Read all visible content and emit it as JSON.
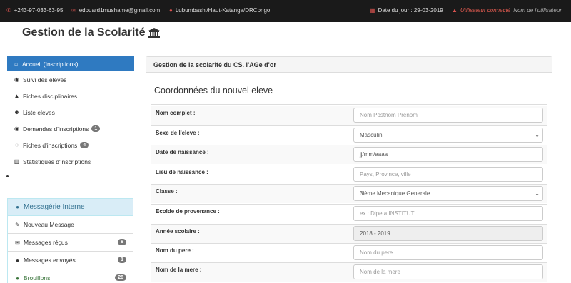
{
  "topbar": {
    "phone": "+243-97-033-63-95",
    "email": "edouard1mushame@gmail.com",
    "location": "Lubumbashi/Haut-Katanga/DRCongo",
    "date": "Date du jour : 29-03-2019",
    "user_status": "Utilisateur connecté",
    "user_name": "Nom de l'utilisateur"
  },
  "brand": {
    "title": "Gestion de la Scolarité"
  },
  "sidebar": {
    "items": [
      {
        "label": "Accueil (Inscriptions)",
        "icon": "home-icon",
        "active": true
      },
      {
        "label": "Suivi des eleves",
        "icon": "eye-icon"
      },
      {
        "label": "Fiches disciplinaires",
        "icon": "warning-icon"
      },
      {
        "label": "Liste eleves",
        "icon": "users-icon"
      },
      {
        "label": "Demandes d'inscriptions",
        "icon": "eye-icon",
        "badge": "1"
      },
      {
        "label": "Fiches d'inscriptions",
        "icon": "whatsapp-icon",
        "badge": "4"
      },
      {
        "label": "Statistiques d'inscriptions",
        "icon": "bar-chart-icon"
      }
    ]
  },
  "messaging": {
    "title": "Messagérie Interne",
    "items": [
      {
        "label": "Nouveau Message",
        "icon": "edit-icon"
      },
      {
        "label": "Messages réçus",
        "icon": "envelope-icon",
        "badge": "8"
      },
      {
        "label": "Messages envoyés",
        "icon": "comments-icon",
        "badge": "1"
      },
      {
        "label": "Brouillons",
        "icon": "comments-icon",
        "badge": "28"
      }
    ]
  },
  "main": {
    "heading": "Gestion de la scolarité du CS. l'AGe d'or",
    "section_title": "Coordonnées du nouvel eleve",
    "fields": [
      {
        "label": "Nom complet :",
        "placeholder": "Nom Postnom Prenom",
        "value": ""
      },
      {
        "label": "Sexe de l'eleve :",
        "value": "Masculin",
        "select": true
      },
      {
        "label": "Date de naissance :",
        "value": "jj/mm/aaaa"
      },
      {
        "label": "Lieu de naissance :",
        "placeholder": "Pays, Province, ville",
        "value": ""
      },
      {
        "label": "Classe :",
        "value": "3ième Mecanique Generale",
        "select": true
      },
      {
        "label": "Ecolde de provenance :",
        "placeholder": "ex : Dipeta INSTITUT",
        "value": ""
      },
      {
        "label": "Année scolaire :",
        "value": "2018 - 2019",
        "disabled": true
      },
      {
        "label": "Nom du pere :",
        "placeholder": "Nom du pere",
        "value": ""
      },
      {
        "label": "Nom de la mere :",
        "placeholder": "Nom de la mere",
        "value": ""
      }
    ]
  },
  "colors": {
    "topbar_bg": "#1a1a1a",
    "accent": "#2f7ac1",
    "icon_red": "#d9534f",
    "panel_info_bg": "#d9edf7"
  }
}
